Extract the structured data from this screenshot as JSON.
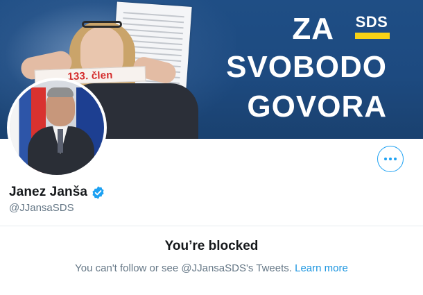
{
  "banner": {
    "slogan_line1": "ZA",
    "slogan_line2": "SVOBODO",
    "slogan_line3": "GOVORA",
    "logo_text": "SDS",
    "tape_text": "133. člen"
  },
  "profile": {
    "name": "Janez Janša",
    "handle": "@JJansaSDS",
    "verified": true,
    "more_icon": "more-horizontal-icon"
  },
  "blocked": {
    "title": "You’re blocked",
    "message": "You can't follow or see @JJansaSDS's Tweets.",
    "learn_more": "Learn more"
  },
  "colors": {
    "accent": "#1da1f2",
    "banner": "#1f4e85",
    "logo_bar": "#f7d215",
    "tape_text": "#d42a2a"
  }
}
